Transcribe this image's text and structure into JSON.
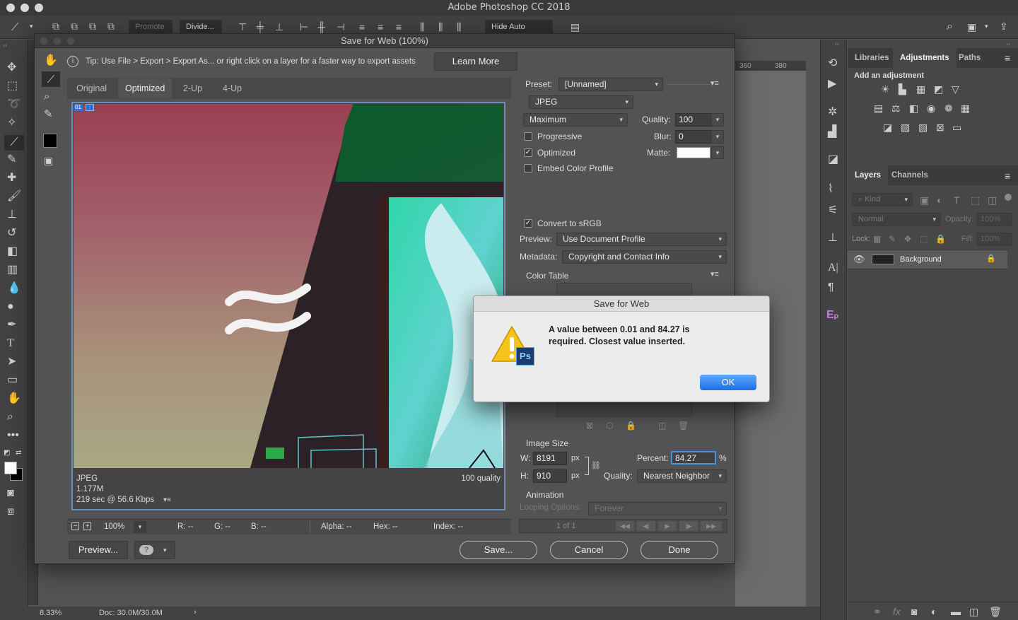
{
  "app": {
    "title": "Adobe Photoshop CC 2018"
  },
  "optionsbar": {
    "promote": "Promote",
    "divide": "Divide...",
    "hide_auto_slices": "Hide Auto Slices"
  },
  "dialog": {
    "title": "Save for Web (100%)",
    "tip": "Tip: Use File > Export > Export As...  or right click on a layer for a faster way to export assets",
    "learn_more": "Learn More",
    "tabs": [
      "Original",
      "Optimized",
      "2-Up",
      "4-Up"
    ],
    "slice_badge": "01",
    "preview_info": {
      "format": "JPEG",
      "size": "1.177M",
      "time": "219 sec @ 56.6 Kbps",
      "quality": "100 quality"
    },
    "statusbar": {
      "zoom": "100%",
      "r": "R: --",
      "g": "G: --",
      "b": "B: --",
      "alpha": "Alpha: --",
      "hex": "Hex: --",
      "index": "Index: --"
    },
    "buttons": {
      "preview": "Preview...",
      "save": "Save...",
      "cancel": "Cancel",
      "done": "Done"
    },
    "settings": {
      "preset_label": "Preset:",
      "preset_value": "[Unnamed]",
      "format": "JPEG",
      "compression": "Maximum",
      "quality_label": "Quality:",
      "quality_value": "100",
      "progressive": "Progressive",
      "blur_label": "Blur:",
      "blur_value": "0",
      "optimized": "Optimized",
      "matte_label": "Matte:",
      "embed_profile": "Embed Color Profile",
      "convert_srgb": "Convert to sRGB",
      "preview_label": "Preview:",
      "preview_value": "Use Document Profile",
      "metadata_label": "Metadata:",
      "metadata_value": "Copyright and Contact Info",
      "color_table": "Color Table"
    },
    "image_size": {
      "heading": "Image Size",
      "w_label": "W:",
      "w_value": "8191",
      "h_label": "H:",
      "h_value": "910",
      "px": "px",
      "percent_label": "Percent:",
      "percent_value": "84.27",
      "percent_sign": "%",
      "quality_label": "Quality:",
      "quality_value": "Nearest Neighbor"
    },
    "animation": {
      "heading": "Animation",
      "looping_label": "Looping Options:",
      "looping_value": "Forever",
      "frame": "1 of 1"
    }
  },
  "alert": {
    "title": "Save for Web",
    "message": "A value between 0.01 and 84.27 is required. Closest value inserted.",
    "ok": "OK",
    "app_badge": "Ps"
  },
  "panels": {
    "top_tabs": [
      "Libraries",
      "Adjustments",
      "Paths"
    ],
    "add_adjustment": "Add an adjustment",
    "layer_tabs": [
      "Layers",
      "Channels"
    ],
    "kind": "Kind",
    "blend_mode": "Normal",
    "opacity_label": "Opacity:",
    "opacity_value": "100%",
    "lock_label": "Lock:",
    "fill_label": "Fill:",
    "fill_value": "100%",
    "layer_name": "Background"
  },
  "ruler": {
    "marks": [
      "360",
      "380"
    ]
  },
  "status": {
    "zoom": "8.33%",
    "doc": "Doc: 30.0M/30.0M"
  },
  "colors": {
    "ok_button": "#2f84f5",
    "accent": "#4a90e2",
    "ps_badge": "#1b3d6d"
  }
}
